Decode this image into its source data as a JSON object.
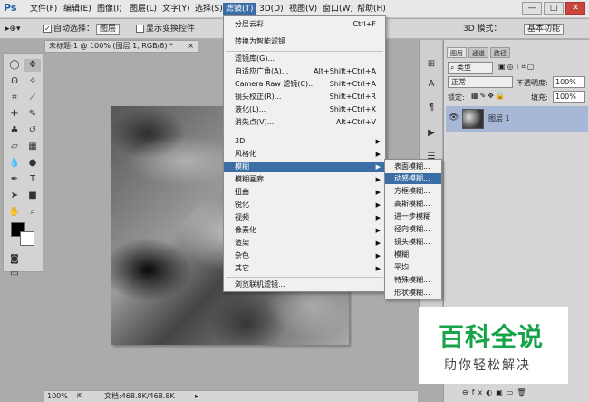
{
  "app": {
    "logo": "Ps"
  },
  "menubar": {
    "items": [
      "文件(F)",
      "编辑(E)",
      "图像(I)",
      "图层(L)",
      "文字(Y)",
      "选择(S)",
      "滤镜(T)",
      "3D(D)",
      "视图(V)",
      "窗口(W)",
      "帮助(H)"
    ],
    "active_index": 6
  },
  "window_controls": {
    "minimize": "—",
    "maximize": "□",
    "close": "✕"
  },
  "options": {
    "auto_select_label": "自动选择：",
    "auto_select_value": "图层",
    "show_transform_label": "显示变换控件",
    "mode_3d_label": "3D 模式：",
    "workspace_value": "基本功能"
  },
  "document": {
    "tab_title": "未标题-1 @ 100% (图层 1, RGB/8) *",
    "zoom": "100%",
    "status": "文档:468.8K/468.8K"
  },
  "filter_menu": {
    "top": [
      {
        "label": "分层云彩",
        "shortcut": "Ctrl+F"
      },
      {
        "label": "转换为智能滤镜"
      },
      {
        "label": "滤镜库(G)..."
      },
      {
        "label": "自适应广角(A)...",
        "shortcut": "Alt+Shift+Ctrl+A"
      },
      {
        "label": "Camera Raw 滤镜(C)...",
        "shortcut": "Shift+Ctrl+A"
      },
      {
        "label": "镜头校正(R)...",
        "shortcut": "Shift+Ctrl+R"
      },
      {
        "label": "液化(L)...",
        "shortcut": "Shift+Ctrl+X"
      },
      {
        "label": "消失点(V)...",
        "shortcut": "Alt+Ctrl+V"
      }
    ],
    "submenus": [
      "3D",
      "风格化",
      "模糊",
      "模糊画廊",
      "扭曲",
      "锐化",
      "视频",
      "像素化",
      "渲染",
      "杂色",
      "其它"
    ],
    "highlighted_submenu": "模糊",
    "browse": "浏览联机滤镜..."
  },
  "blur_submenu": {
    "items": [
      "表面模糊...",
      "动感模糊...",
      "方框模糊...",
      "高斯模糊...",
      "进一步模糊",
      "径向模糊...",
      "镜头模糊...",
      "模糊",
      "平均",
      "特殊模糊...",
      "形状模糊..."
    ],
    "highlighted": "动感模糊..."
  },
  "layers_panel": {
    "tabs": [
      "图层",
      "通道",
      "路径"
    ],
    "kind_filter": "类型",
    "blend_mode": "正常",
    "opacity_label": "不透明度:",
    "opacity_value": "100%",
    "lock_label": "锁定:",
    "fill_label": "填充:",
    "fill_value": "100%",
    "layer_name": "图层 1"
  },
  "watermark": {
    "title": "百科全说",
    "subtitle": "助你轻松解决"
  },
  "colors": {
    "highlight": "#3a6ea5",
    "layer_selected": "#a7b7d6",
    "watermark_green": "#17a34a"
  }
}
